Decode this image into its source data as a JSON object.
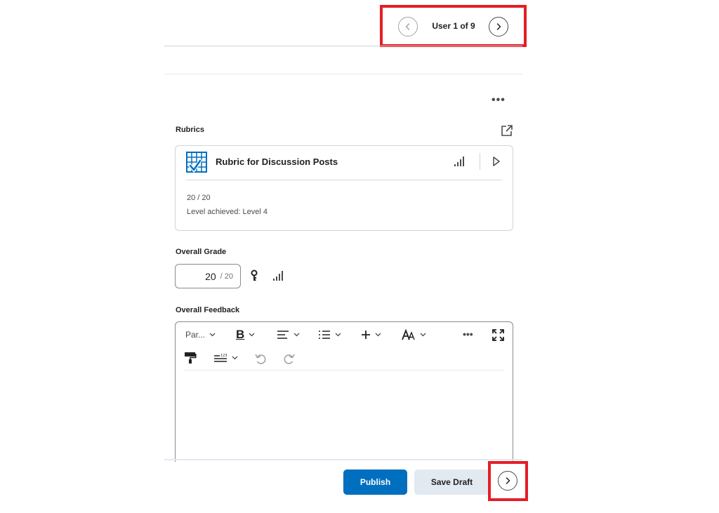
{
  "navigator": {
    "user_count": "User 1 of 9",
    "prev_icon": "chevron-left-icon",
    "next_icon": "chevron-right-icon",
    "highlight_color": "#e41e26"
  },
  "rubrics": {
    "section_label": "Rubrics",
    "card": {
      "title": "Rubric for Discussion Posts",
      "score": "20 / 20",
      "level": "Level achieved: Level 4"
    }
  },
  "overall_grade": {
    "label": "Overall Grade",
    "value": "20",
    "max": "/ 20"
  },
  "overall_feedback": {
    "label": "Overall Feedback",
    "toolbar": {
      "paragraph_format": "Par...",
      "bold": "B",
      "more": "•••"
    }
  },
  "footer": {
    "publish_label": "Publish",
    "save_draft_label": "Save Draft"
  },
  "colors": {
    "primary": "#006fbf",
    "secondary_button": "#e3e9f1",
    "annotation": "#e41e26"
  }
}
